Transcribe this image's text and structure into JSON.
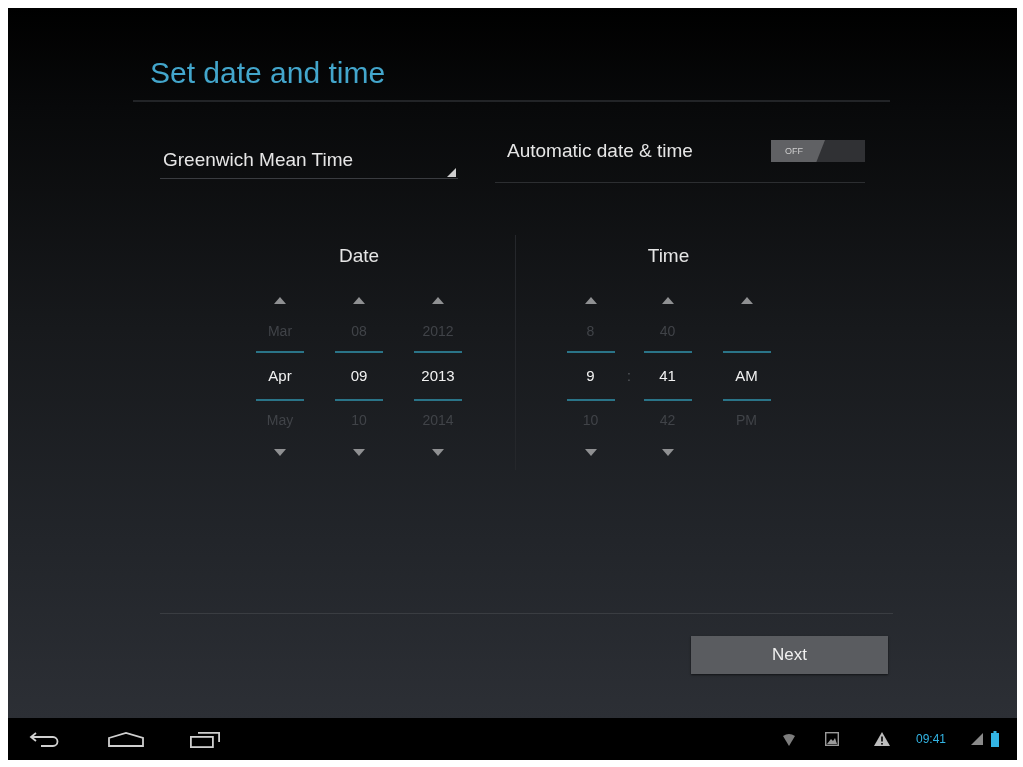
{
  "title": "Set date and time",
  "timezone": {
    "value": "Greenwich Mean Time"
  },
  "automatic": {
    "label": "Automatic date & time",
    "on": false,
    "switch_text": "OFF"
  },
  "date": {
    "heading": "Date",
    "columns": [
      {
        "prev": "Mar",
        "value": "Apr",
        "next": "May",
        "up": true,
        "down": true
      },
      {
        "prev": "08",
        "value": "09",
        "next": "10",
        "up": true,
        "down": true
      },
      {
        "prev": "2012",
        "value": "2013",
        "next": "2014",
        "up": true,
        "down": true
      }
    ]
  },
  "time": {
    "heading": "Time",
    "separator": ":",
    "columns": [
      {
        "prev": "8",
        "value": "9",
        "next": "10",
        "up": true,
        "down": true
      },
      {
        "prev": "40",
        "value": "41",
        "next": "42",
        "up": true,
        "down": true
      },
      {
        "value": "AM",
        "next": "PM",
        "up": true,
        "down": false
      }
    ]
  },
  "next_button": {
    "label": "Next"
  },
  "nav_bar": {
    "clock": "09:41"
  }
}
